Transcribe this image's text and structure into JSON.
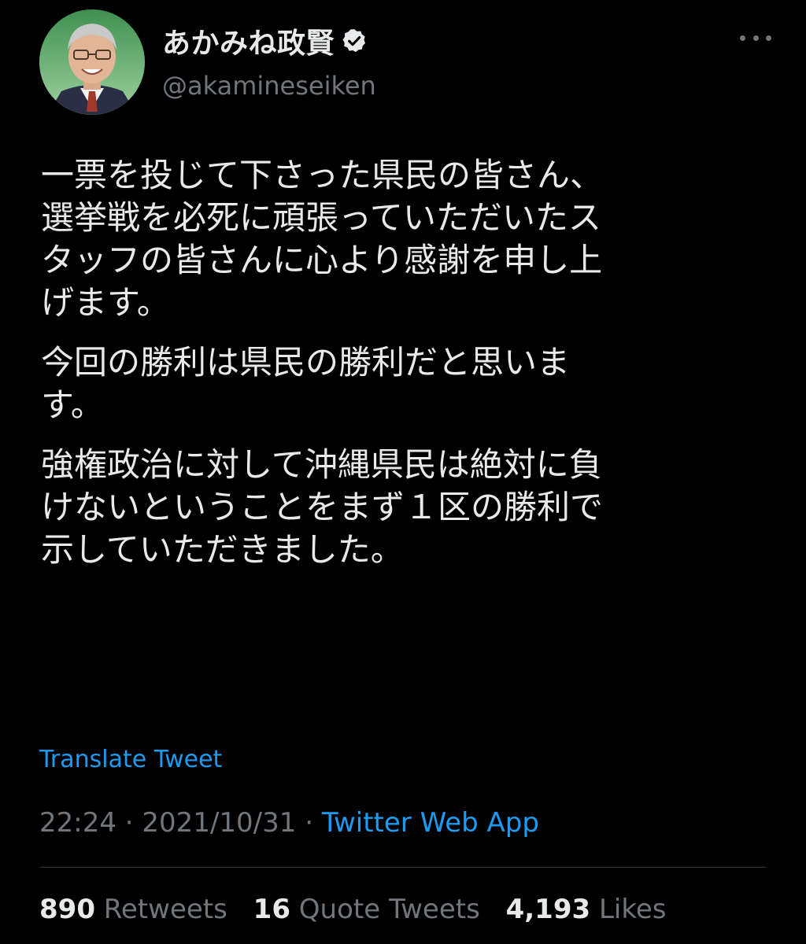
{
  "user": {
    "display_name": "あかみね政賢",
    "handle": "@akamineseiken",
    "verified_icon": "verified-badge-icon",
    "more_icon": "more-horizontal-icon"
  },
  "tweet": {
    "paragraphs": [
      "一票を投じて下さった県民の皆さん、\n選挙戦を必死に頑張っていただいたス\nタッフの皆さんに心より感謝を申し上\nげます。",
      "今回の勝利は県民の勝利だと思いま\nす。",
      "強権政治に対して沖縄県民は絶対に負\nけないということをまず１区の勝利で\n示していただきました。"
    ],
    "translate_label": "Translate Tweet",
    "time": "22:24",
    "date": "2021/10/31",
    "separator": "·",
    "source": "Twitter Web App"
  },
  "stats": {
    "retweets_count": "890",
    "retweets_label": "Retweets",
    "quotes_count": "16",
    "quotes_label": "Quote Tweets",
    "likes_count": "4,193",
    "likes_label": "Likes"
  },
  "colors": {
    "background": "#000000",
    "text_primary": "#e7e9ea",
    "text_secondary": "#71767b",
    "link": "#1d9bf0",
    "divider": "#2f3336"
  }
}
